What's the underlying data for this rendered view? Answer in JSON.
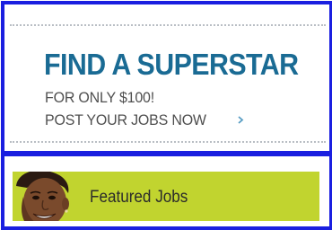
{
  "ad": {
    "headline": "FIND A SUPERSTAR",
    "price_line": "FOR ONLY $100!",
    "cta": "POST YOUR JOBS NOW",
    "cta_icon": "chevron-right-icon"
  },
  "featured": {
    "label": "Featured Jobs",
    "avatar_icon": "person-photo"
  },
  "colors": {
    "border": "#1a1fe0",
    "headline": "#1a6b94",
    "bar": "#c1d42f"
  }
}
